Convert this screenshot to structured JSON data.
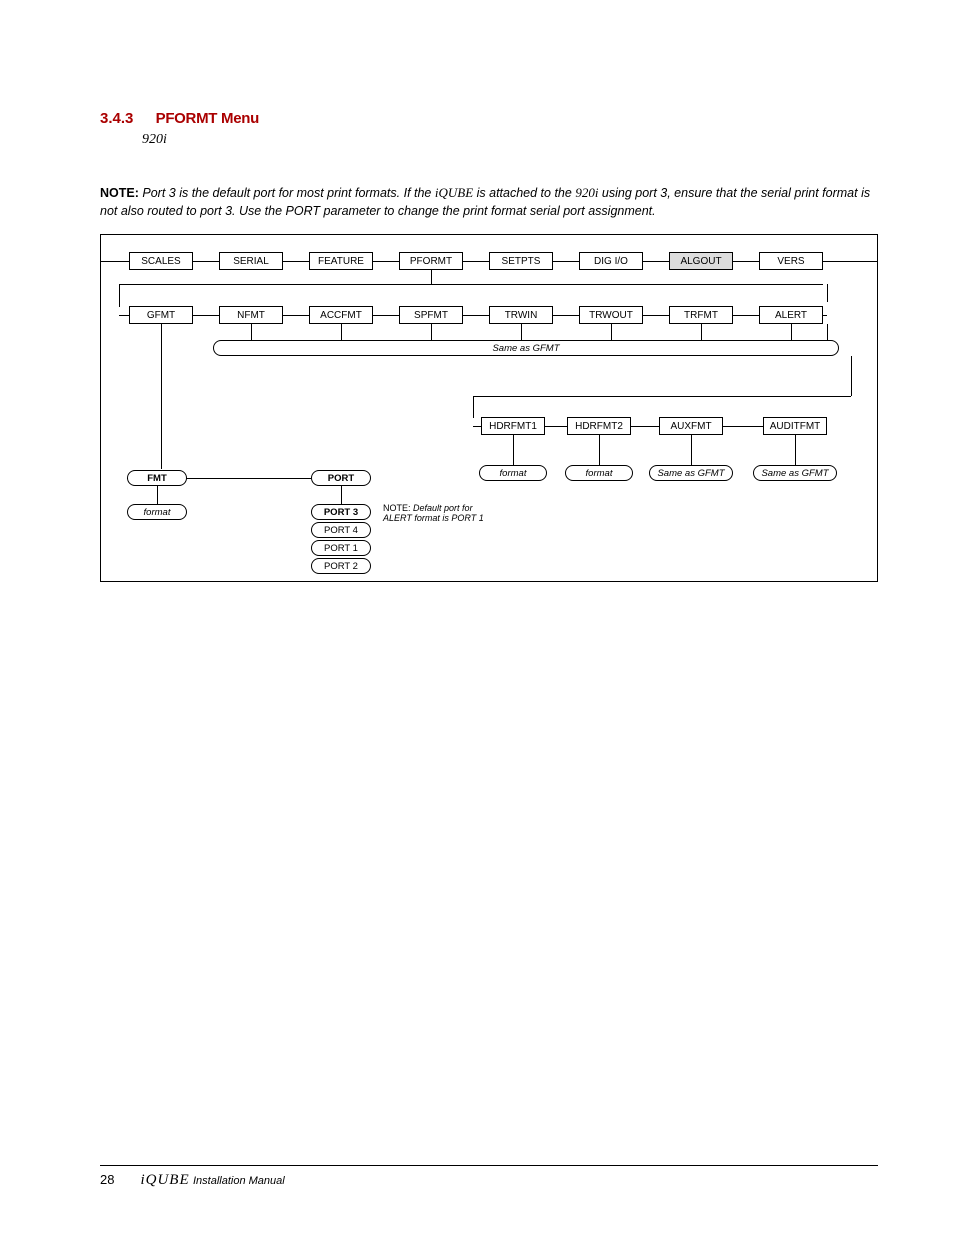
{
  "heading": {
    "number": "3.4.3",
    "title": "PFORMT Menu",
    "subtitle": "920i"
  },
  "note": {
    "label": "NOTE:",
    "t1": "Port 3 is the default port for most print formats. If the ",
    "dev1": "iQUBE",
    "t2": " is attached to the ",
    "dev2": "920i",
    "t3": " using port 3, ensure that the serial print format is not also routed to port 3. Use the PORT parameter to change the print format serial port assignment."
  },
  "row1": [
    "SCALES",
    "SERIAL",
    "FEATURE",
    "PFORMT",
    "SETPTS",
    "DIG I/O",
    "ALGOUT",
    "VERS"
  ],
  "row2": [
    "GFMT",
    "NFMT",
    "ACCFMT",
    "SPFMT",
    "TRWIN",
    "TRWOUT",
    "TRFMT",
    "ALERT"
  ],
  "same_as_gfmt": "Same as GFMT",
  "row3": [
    "HDRFMT1",
    "HDRFMT2",
    "AUXFMT",
    "AUDITFMT"
  ],
  "row3_sub": [
    "format",
    "format",
    "Same as GFMT",
    "Same as GFMT"
  ],
  "fmt": "FMT",
  "fmt_sub": "format",
  "port": "PORT",
  "port_opts": [
    "PORT 3",
    "PORT 4",
    "PORT 1",
    "PORT 2"
  ],
  "diag_note": {
    "a": "NOTE:",
    "b": "Default port for",
    "c": "ALERT format is PORT 1"
  },
  "footer": {
    "page": "28",
    "product": "iQUBE",
    "rest": "Installation Manual"
  }
}
